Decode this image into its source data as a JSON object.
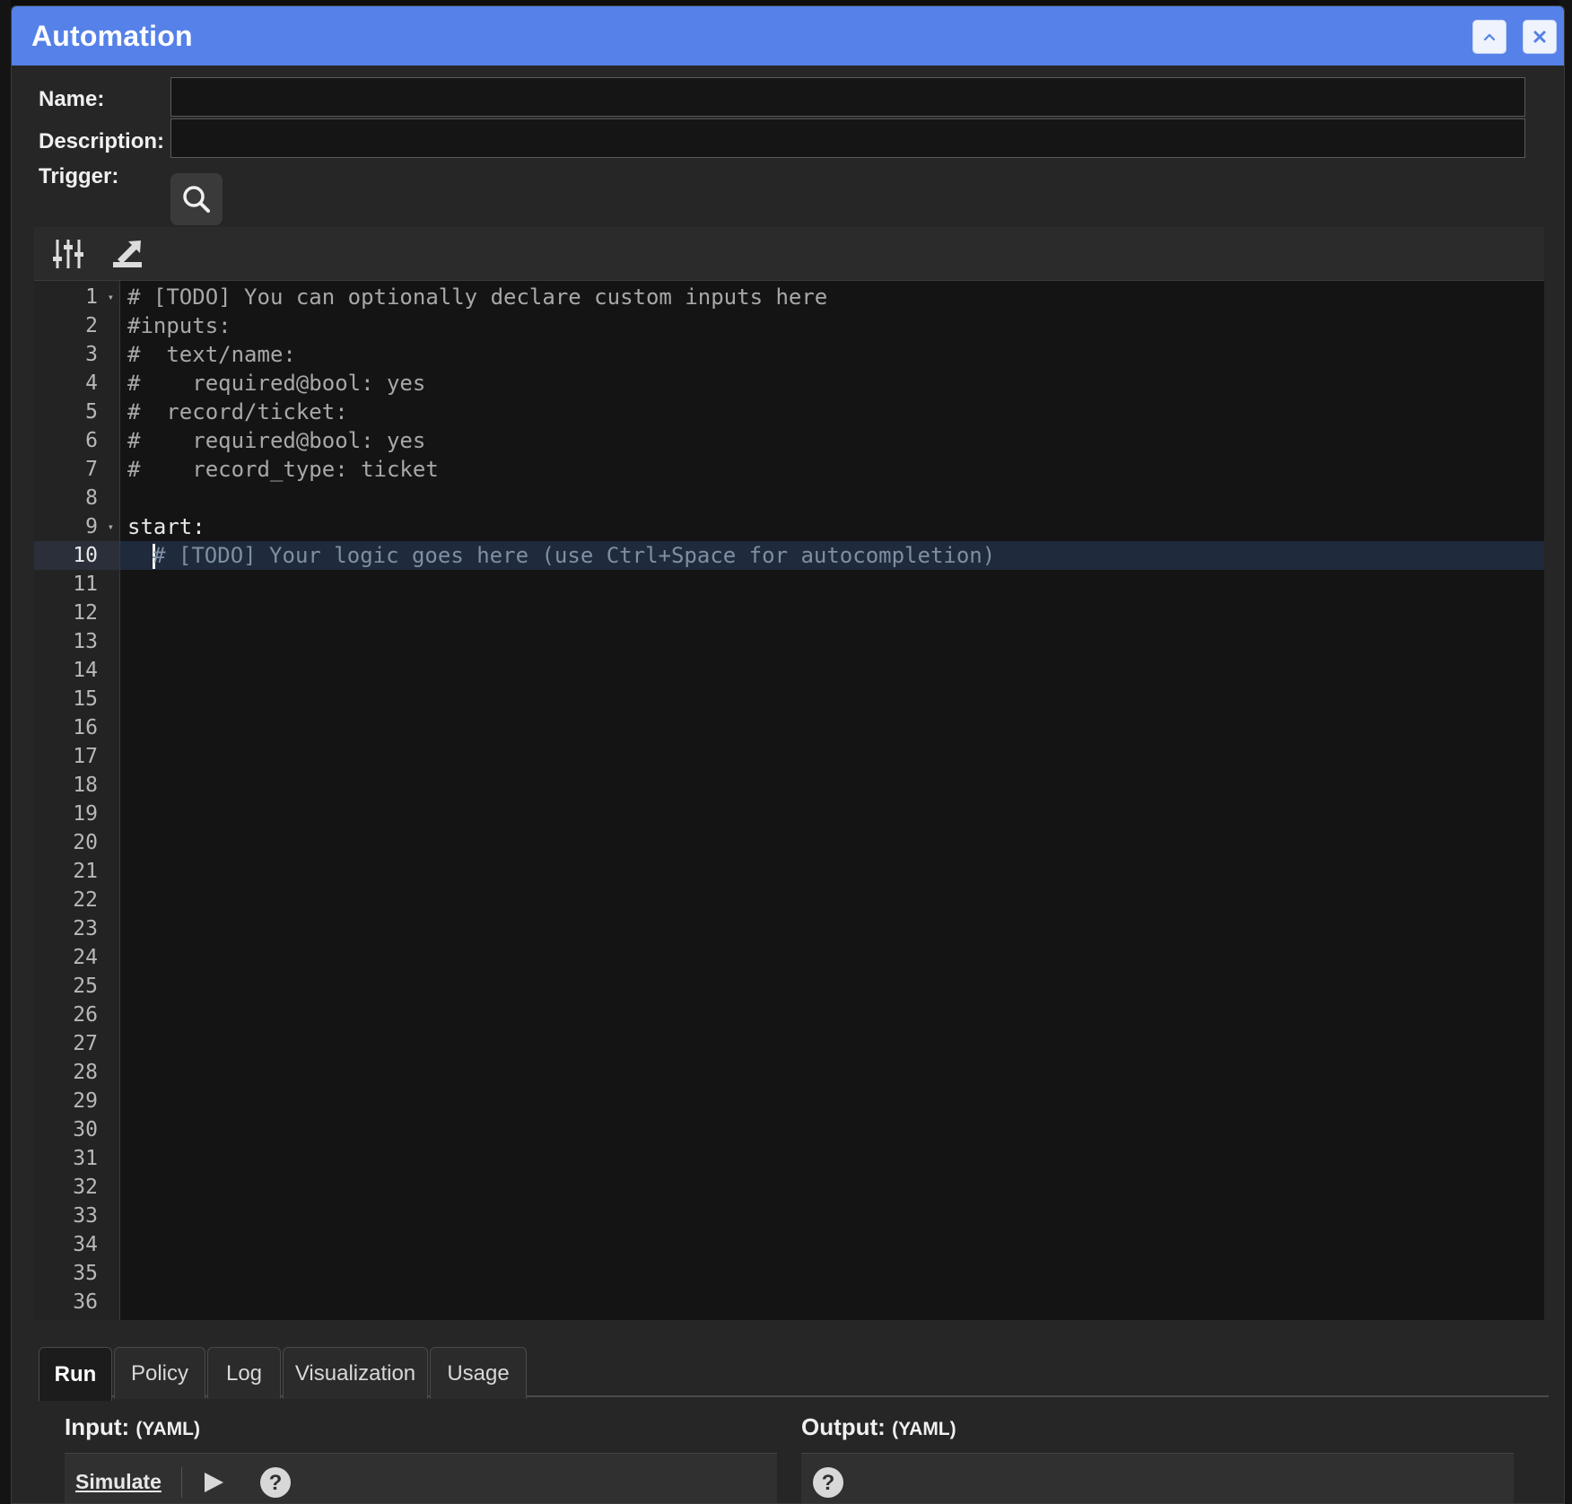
{
  "window": {
    "title": "Automation"
  },
  "form": {
    "name_label": "Name:",
    "name_value": "",
    "description_label": "Description:",
    "description_value": "",
    "trigger_label": "Trigger:"
  },
  "editor": {
    "line_numbers": [
      "1",
      "2",
      "3",
      "4",
      "5",
      "6",
      "7",
      "8",
      "9",
      "10",
      "11",
      "12",
      "13",
      "14",
      "15",
      "16",
      "17",
      "18",
      "19",
      "20",
      "21",
      "22",
      "23",
      "24",
      "25",
      "26",
      "27",
      "28",
      "29",
      "30",
      "31",
      "32",
      "33",
      "34",
      "35",
      "36"
    ],
    "lines": [
      "# [TODO] You can optionally declare custom inputs here",
      "#inputs:",
      "#  text/name:",
      "#    required@bool: yes",
      "#  record/ticket:",
      "#    required@bool: yes",
      "#    record_type: ticket",
      "",
      "start:",
      "# [TODO] Your logic goes here (use Ctrl+Space for autocompletion)"
    ],
    "active_line": 10
  },
  "tabs": [
    "Run",
    "Policy",
    "Log",
    "Visualization",
    "Usage"
  ],
  "run": {
    "input_title": "Input:",
    "input_format": "(YAML)",
    "output_title": "Output:",
    "output_format": "(YAML)",
    "simulate_label": "Simulate"
  },
  "colors": {
    "titlebar": "#5581e8",
    "window_bg": "#262626",
    "editor_bg": "#141414"
  }
}
